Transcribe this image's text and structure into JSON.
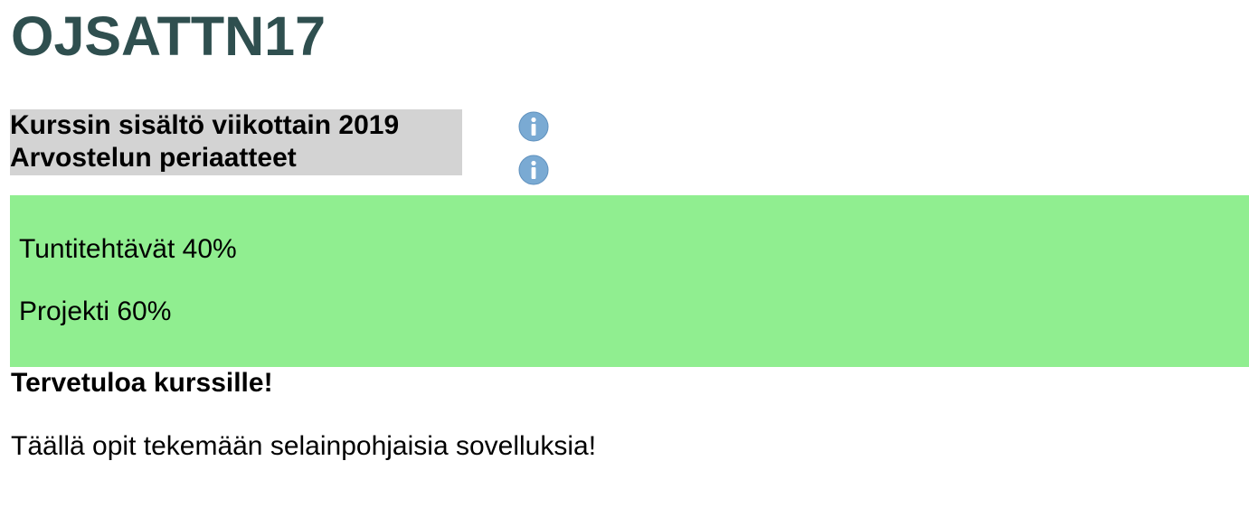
{
  "page": {
    "title": "OJSATTN17"
  },
  "menu": {
    "items": [
      {
        "label": "Kurssin sisältö viikottain 2019",
        "icon": "info-icon"
      },
      {
        "label": "Arvostelun periaatteet",
        "icon": "info-icon"
      }
    ],
    "background_color": "#d3d3d3"
  },
  "grading": {
    "background_color": "#90ee90",
    "lines": [
      "Tuntitehtävät 40%",
      "Projekti 60%"
    ]
  },
  "welcome": {
    "heading": "Tervetuloa kurssille!",
    "text": "Täällä opit tekemään selainpohjaisia sovelluksia!"
  },
  "colors": {
    "title": "#2f4f4f",
    "icon": "#7aaad3"
  }
}
